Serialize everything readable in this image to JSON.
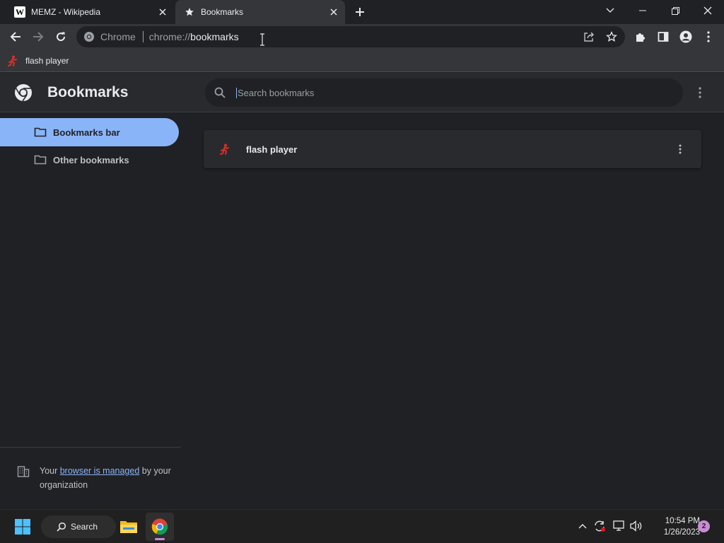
{
  "browser": {
    "tabs": [
      {
        "title": "MEMZ - Wikipedia",
        "favicon": "wikipedia-w-icon",
        "active": false
      },
      {
        "title": "Bookmarks",
        "favicon": "star-icon",
        "active": true
      }
    ],
    "omnibox": {
      "site_chip": "Chrome",
      "url_scheme": "chrome://",
      "url_host": "bookmarks"
    },
    "bookmarks_bar": [
      {
        "label": "flash player",
        "icon": "red-running-figure-icon"
      }
    ]
  },
  "page": {
    "title": "Bookmarks",
    "search_placeholder": "Search bookmarks",
    "sidebar": {
      "items": [
        {
          "label": "Bookmarks bar",
          "selected": true
        },
        {
          "label": "Other bookmarks",
          "selected": false
        }
      ],
      "managed": {
        "prefix": "Your ",
        "link": "browser is managed",
        "suffix": " by your organization"
      }
    },
    "bookmarks": [
      {
        "label": "flash player",
        "icon": "red-running-figure-icon"
      }
    ]
  },
  "taskbar": {
    "search_label": "Search",
    "time": "10:54 PM",
    "date": "1/26/2023",
    "notification_count": "2"
  },
  "colors": {
    "accent": "#8ab4f8",
    "background": "#202124",
    "toolbar": "#35363a",
    "favicon_red": "#d93025"
  }
}
